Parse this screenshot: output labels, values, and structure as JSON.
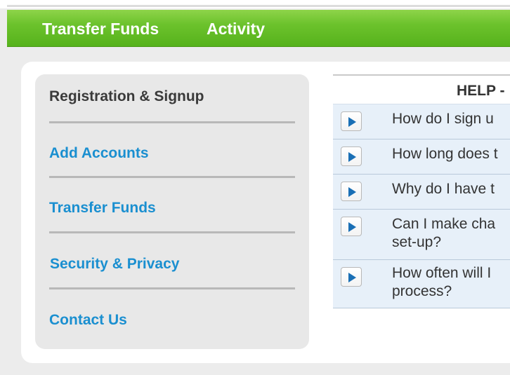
{
  "nav": {
    "items": [
      {
        "label": "Transfer Funds"
      },
      {
        "label": "Activity"
      }
    ]
  },
  "sidebar": {
    "items": [
      {
        "label": "Registration & Signup",
        "active": true
      },
      {
        "label": "Add Accounts",
        "active": false
      },
      {
        "label": "Transfer Funds",
        "active": false
      },
      {
        "label": "Security & Privacy",
        "active": false
      },
      {
        "label": "Contact Us",
        "active": false
      }
    ]
  },
  "help": {
    "header": "HELP -",
    "questions": [
      {
        "line1": "How do I sign u",
        "line2": ""
      },
      {
        "line1": "How long does t",
        "line2": ""
      },
      {
        "line1": "Why do I have t",
        "line2": ""
      },
      {
        "line1": "Can I make cha",
        "line2": "set-up?"
      },
      {
        "line1": "How often will I",
        "line2": "process?"
      }
    ]
  },
  "colors": {
    "nav_green": "#6cc22c",
    "link_blue": "#1a8fd0",
    "play_icon": "#1a6fb5",
    "faq_row_bg": "#e7f0f9"
  },
  "icons": {
    "faq_expand": "play-icon"
  }
}
